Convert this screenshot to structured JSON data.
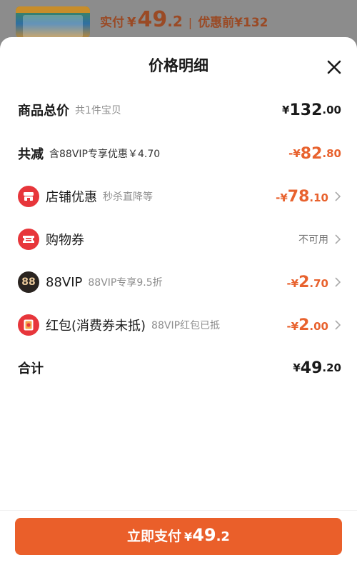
{
  "topbar": {
    "paid_label": "实付",
    "currency": "¥",
    "paid_int": "49",
    "paid_dec": ".2",
    "separator": "|",
    "before_label": "优惠前¥132"
  },
  "sheet": {
    "title": "价格明细"
  },
  "rows": {
    "total": {
      "label": "商品总价",
      "sub": "共1件宝贝",
      "currency": "¥",
      "int": "132",
      "dec": ".00"
    },
    "reduce": {
      "label": "共减",
      "sub": "含88VIP专享优惠￥4.70",
      "currency": "-¥",
      "int": "82",
      "dec": ".80"
    },
    "store": {
      "label": "店铺优惠",
      "sub": "秒杀直降等",
      "currency": "-¥",
      "int": "78",
      "dec": ".10",
      "icon": "store-icon"
    },
    "coupon": {
      "label": "购物券",
      "value": "不可用",
      "icon": "ticket-icon"
    },
    "vip": {
      "label": "88VIP",
      "sub": "88VIP专享9.5折",
      "currency": "-¥",
      "int": "2",
      "dec": ".70",
      "icon_text": "88"
    },
    "redpack": {
      "label": "红包(消费券未抵)",
      "sub": "88VIP红包已抵",
      "currency": "-¥",
      "int": "2",
      "dec": ".00",
      "icon": "red-envelope-icon"
    },
    "sum": {
      "label": "合计",
      "currency": "¥",
      "int": "49",
      "dec": ".20"
    }
  },
  "pay_button": {
    "label": "立即支付",
    "currency": "¥",
    "int": "49",
    "dec": ".2"
  },
  "colors": {
    "accent": "#ea5f2a",
    "price_orange": "#e8622e",
    "icon_red": "#e7363b",
    "vip_dark": "#2a2420"
  }
}
